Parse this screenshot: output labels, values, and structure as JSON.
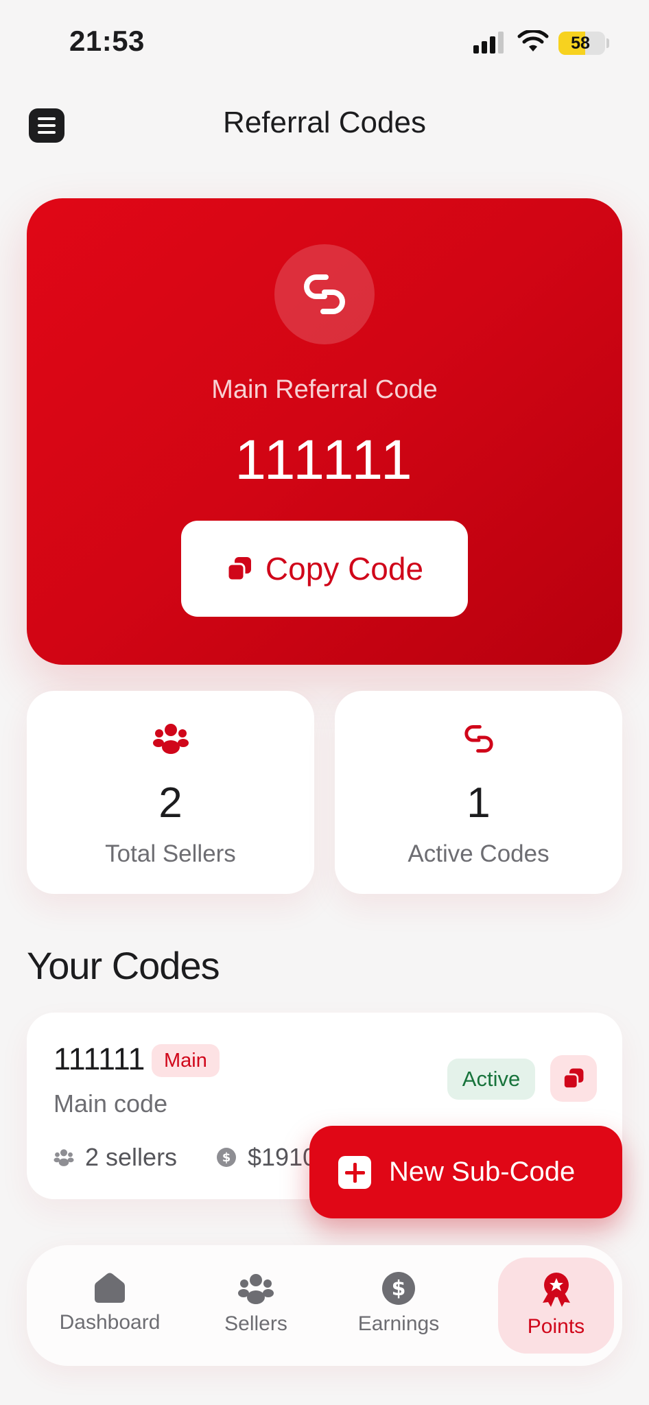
{
  "status_bar": {
    "time": "21:53",
    "battery": "58",
    "battery_level": 0.58
  },
  "header": {
    "title": "Referral Codes",
    "menu_icon": "menu-icon"
  },
  "hero": {
    "icon": "link-icon",
    "label": "Main Referral Code",
    "code": "111111",
    "copy_button": {
      "icon": "copy-icon",
      "label": "Copy Code"
    }
  },
  "stats": [
    {
      "icon": "users-icon",
      "value": "2",
      "label": "Total Sellers"
    },
    {
      "icon": "link-icon",
      "value": "1",
      "label": "Active Codes"
    }
  ],
  "codes_section": {
    "title": "Your Codes",
    "items": [
      {
        "code": "111111",
        "badge": "Main",
        "description": "Main code",
        "sellers": "2 sellers",
        "earnings": "$1910",
        "status": "Active",
        "copy_icon": "copy-icon"
      }
    ]
  },
  "fab": {
    "icon": "plus-icon",
    "label": "New Sub-Code"
  },
  "tabbar": {
    "items": [
      {
        "label": "Dashboard",
        "icon": "home-icon",
        "active": false
      },
      {
        "label": "Sellers",
        "icon": "users-icon",
        "active": false
      },
      {
        "label": "Earnings",
        "icon": "dollar-icon",
        "active": false
      },
      {
        "label": "Points",
        "icon": "award-icon",
        "active": true
      }
    ]
  },
  "colors": {
    "brand_red": "#e00716",
    "text_red": "#d0061a",
    "success_green": "#17733b",
    "background": "#f6f5f5"
  }
}
